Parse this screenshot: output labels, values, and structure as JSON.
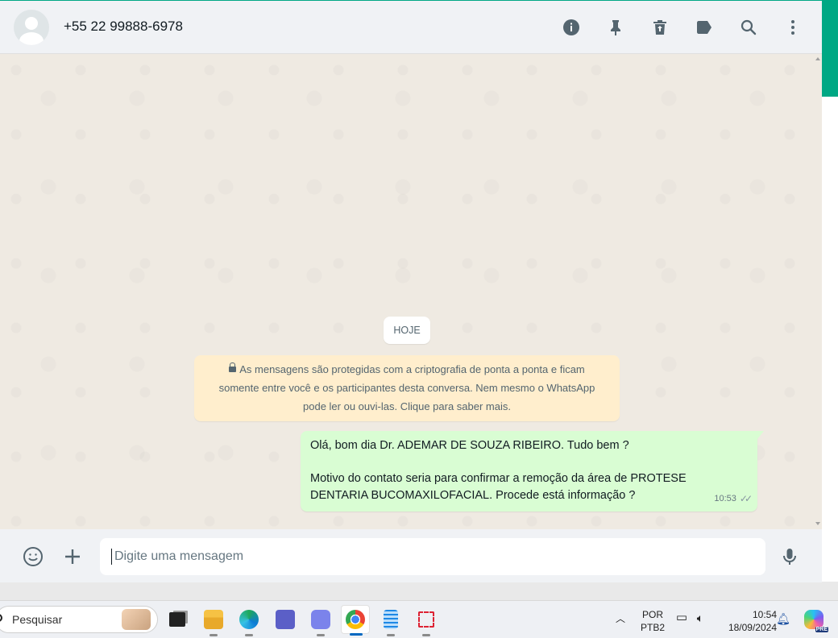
{
  "header": {
    "contact_name": "+55 22 99888-6978",
    "icons": [
      "info-icon",
      "pin-icon",
      "delete-icon",
      "label-icon",
      "search-icon",
      "menu-icon"
    ]
  },
  "chat": {
    "date_chip": "HOJE",
    "encryption_notice": {
      "line1": "As mensagens são protegidas com a criptografia de ponta a ponta e ficam",
      "line2": "somente entre você e os participantes desta conversa. Nem mesmo o WhatsApp",
      "line3": "pode ler ou ouvi-las. Clique para saber mais."
    },
    "messages": [
      {
        "direction": "outgoing",
        "line1": "Olá, bom dia Dr. ADEMAR DE SOUZA RIBEIRO. Tudo bem ?",
        "line2": "Motivo do contato seria para confirmar a remoção da área de  PROTESE",
        "line3": "DENTARIA BUCOMAXILOFACIAL. Procede está informação ?",
        "time": "10:53",
        "status": "delivered"
      }
    ]
  },
  "composer": {
    "placeholder": "Digite uma mensagem"
  },
  "taskbar": {
    "search_label": "Pesquisar",
    "lang_line1": "POR",
    "lang_line2": "PTB2",
    "time": "10:54",
    "date": "18/09/2024",
    "copilot_badge": "PRE"
  },
  "colors": {
    "accent": "#00a884",
    "outgoing_bubble": "#d9fdd3",
    "notice_bg": "#ffeecd",
    "chat_bg": "#efeae2"
  }
}
